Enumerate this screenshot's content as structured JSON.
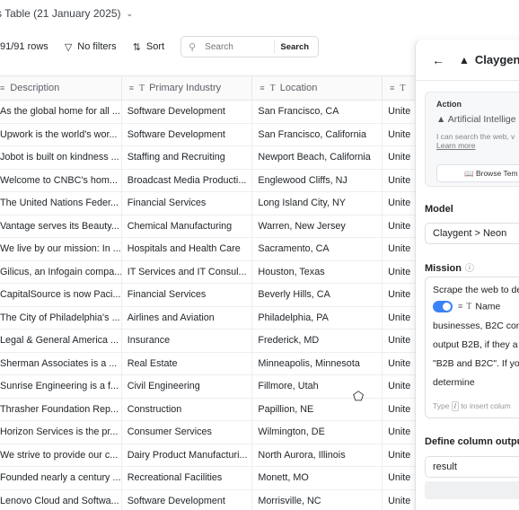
{
  "header": {
    "title": "s Table (21 January 2025)"
  },
  "toolbar": {
    "rows_count": "91/91 rows",
    "filter_label": "No filters",
    "sort_label": "Sort",
    "search_placeholder": "Search",
    "search_button": "Search"
  },
  "table": {
    "columns": [
      "Description",
      "Primary Industry",
      "Location",
      "T"
    ],
    "rows": [
      [
        "As the global home for all ...",
        "Software Development",
        "San Francisco, CA",
        "Unite"
      ],
      [
        "Upwork is the world's wor...",
        "Software Development",
        "San Francisco, California",
        "Unite"
      ],
      [
        "Jobot is built on kindness ...",
        "Staffing and Recruiting",
        "Newport Beach, California",
        "Unite"
      ],
      [
        "Welcome to CNBC's hom...",
        "Broadcast Media Producti...",
        "Englewood Cliffs, NJ",
        "Unite"
      ],
      [
        "The United Nations Feder...",
        "Financial Services",
        "Long Island City, NY",
        "Unite"
      ],
      [
        "Vantage serves its Beauty...",
        "Chemical Manufacturing",
        "Warren, New Jersey",
        "Unite"
      ],
      [
        "We live by our mission: In ...",
        "Hospitals and Health Care",
        "Sacramento, CA",
        "Unite"
      ],
      [
        "Gilicus, an Infogain compa...",
        "IT Services and IT Consul...",
        "Houston, Texas",
        "Unite"
      ],
      [
        "CapitalSource is now Paci...",
        "Financial Services",
        "Beverly Hills, CA",
        "Unite"
      ],
      [
        "The City of Philadelphia's ...",
        "Airlines and Aviation",
        "Philadelphia, PA",
        "Unite"
      ],
      [
        "Legal & General America ...",
        "Insurance",
        "Frederick, MD",
        "Unite"
      ],
      [
        "Sherman Associates is a ...",
        "Real Estate",
        "Minneapolis, Minnesota",
        "Unite"
      ],
      [
        "Sunrise Engineering is a f...",
        "Civil Engineering",
        "Fillmore, Utah",
        "Unite"
      ],
      [
        "Thrasher Foundation Rep...",
        "Construction",
        "Papillion, NE",
        "Unite"
      ],
      [
        "Horizon Services is the pr...",
        "Consumer Services",
        "Wilmington, DE",
        "Unite"
      ],
      [
        "We strive to provide our c...",
        "Dairy Product Manufacturi...",
        "North Aurora, Illinois",
        "Unite"
      ],
      [
        "Founded nearly a century ...",
        "Recreational Facilities",
        "Monett, MO",
        "Unite"
      ],
      [
        "Lenovo Cloud and Softwa...",
        "Software Development",
        "Morrisville, NC",
        "Unite"
      ]
    ]
  },
  "panel": {
    "title": "Claygent",
    "action_label": "Action",
    "action_value": "Artificial Intellige",
    "action_desc": "I can search the web, v",
    "learn_more": "Learn more",
    "browse_label": "Browse Tem",
    "model_label": "Model",
    "model_value": "Claygent > Neon",
    "mission_label": "Mission",
    "mission_lines": [
      "Scrape the web to de",
      "businesses, B2C con",
      "output B2B, if they a",
      "\"B2B and B2C\". If yo",
      "determine"
    ],
    "mission_token": "Name",
    "mission_hint_pre": "Type",
    "mission_hint_key": "/",
    "mission_hint_post": "to insert colum",
    "output_label": "Define column output",
    "output_value": "result"
  }
}
